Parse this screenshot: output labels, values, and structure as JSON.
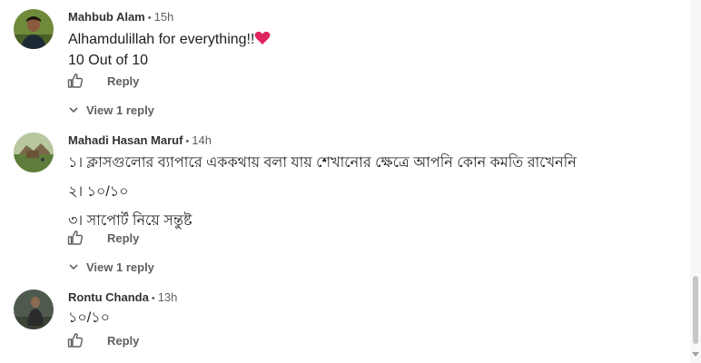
{
  "comments": [
    {
      "author": "Mahbub Alam",
      "time": "15h",
      "lines": [
        "Alhamdulillah for everything!!",
        "10 Out of 10"
      ],
      "emoji": "heart",
      "reply_label": "Reply",
      "view_replies": "View 1 reply"
    },
    {
      "author": "Mahadi Hasan Maruf",
      "time": "14h",
      "lines": [
        "১। ক্লাসগুলোর ব্যাপারে এককথায় বলা যায় শেখানোর ক্ষেত্রে আপনি কোন কমতি রাখেননি",
        "২। ১০/১০",
        "৩। সাপোর্ট নিয়ে সন্তুষ্ট"
      ],
      "reply_label": "Reply",
      "view_replies": "View 1 reply"
    },
    {
      "author": "Rontu Chanda",
      "time": "13h",
      "lines": [
        "১০/১০"
      ],
      "reply_label": "Reply"
    }
  ],
  "separator": "•",
  "colors": {
    "heart": "#e0245e",
    "meta_text": "#606060",
    "author": "#333333"
  }
}
